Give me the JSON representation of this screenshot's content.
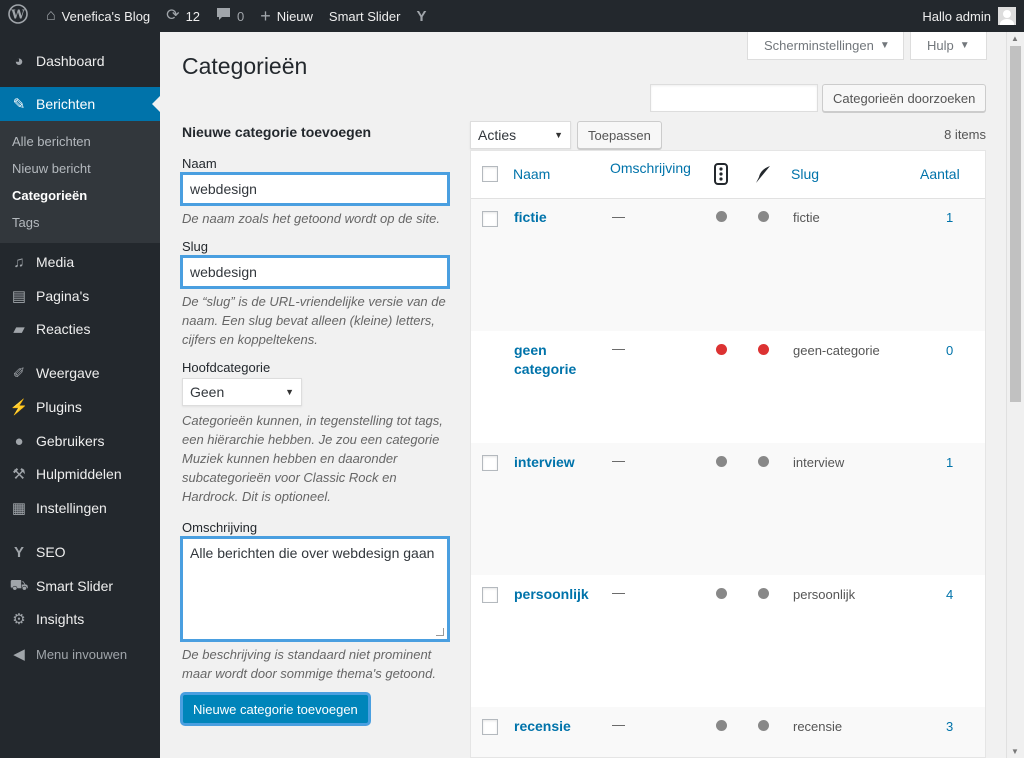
{
  "adminbar": {
    "site_name": "Venefica's Blog",
    "updates_count": "12",
    "comments_count": "0",
    "new_label": "Nieuw",
    "smart_slider": "Smart Slider",
    "greeting": "Hallo admin"
  },
  "menu": {
    "dashboard": "Dashboard",
    "posts": "Berichten",
    "sub": {
      "all_posts": "Alle berichten",
      "new_post": "Nieuw bericht",
      "categories": "Categorieën",
      "tags": "Tags"
    },
    "media": "Media",
    "pages": "Pagina's",
    "comments": "Reacties",
    "appearance": "Weergave",
    "plugins": "Plugins",
    "users": "Gebruikers",
    "tools": "Hulpmiddelen",
    "settings": "Instellingen",
    "seo": "SEO",
    "smart_slider": "Smart Slider",
    "insights": "Insights",
    "collapse": "Menu invouwen"
  },
  "screen_options": "Scherminstellingen",
  "help": "Hulp",
  "page_title": "Categorieën",
  "search": {
    "value": "",
    "button": "Categorieën doorzoeken"
  },
  "form": {
    "heading": "Nieuwe categorie toevoegen",
    "name_label": "Naam",
    "name_value": "webdesign",
    "name_desc": "De naam zoals het getoond wordt op de site.",
    "slug_label": "Slug",
    "slug_value": "webdesign",
    "slug_desc": "De “slug” is de URL-vriendelijke versie van de naam. Een slug bevat alleen (kleine) letters, cijfers en koppeltekens.",
    "parent_label": "Hoofdcategorie",
    "parent_value": "Geen",
    "parent_desc": "Categorieën kunnen, in tegenstelling tot tags, een hiërarchie hebben. Je zou een categorie Muziek kunnen hebben en daaronder subcategorieën voor Classic Rock en Hardrock. Dit is optioneel.",
    "desc_label": "Omschrijving",
    "desc_value": "Alle berichten die over webdesign gaan",
    "desc_desc": "De beschrijving is standaard niet prominent maar wordt door sommige thema's getoond.",
    "submit": "Nieuwe categorie toevoegen"
  },
  "list": {
    "bulk_value": "Acties",
    "apply": "Toepassen",
    "items_count": "8 items",
    "columns": {
      "name": "Naam",
      "description": "Omschrijving",
      "slug": "Slug",
      "count": "Aantal"
    },
    "rows": [
      {
        "name": "fictie",
        "desc": "—",
        "slug": "fictie",
        "count": "1",
        "dots": "grey"
      },
      {
        "name": "geen categorie",
        "desc": "—",
        "slug": "geen-categorie",
        "count": "0",
        "dots": "red"
      },
      {
        "name": "interview",
        "desc": "—",
        "slug": "interview",
        "count": "1",
        "dots": "grey"
      },
      {
        "name": "persoonlijk",
        "desc": "—",
        "slug": "persoonlijk",
        "count": "4",
        "dots": "grey"
      },
      {
        "name": "recensie",
        "desc": "—",
        "slug": "recensie",
        "count": "3",
        "dots": "grey"
      }
    ]
  },
  "colors": {
    "admin_dark": "#23282d",
    "accent": "#0073aa",
    "status_red": "#dc3232",
    "status_grey": "#888888",
    "highlight": "#4a9fe0"
  }
}
